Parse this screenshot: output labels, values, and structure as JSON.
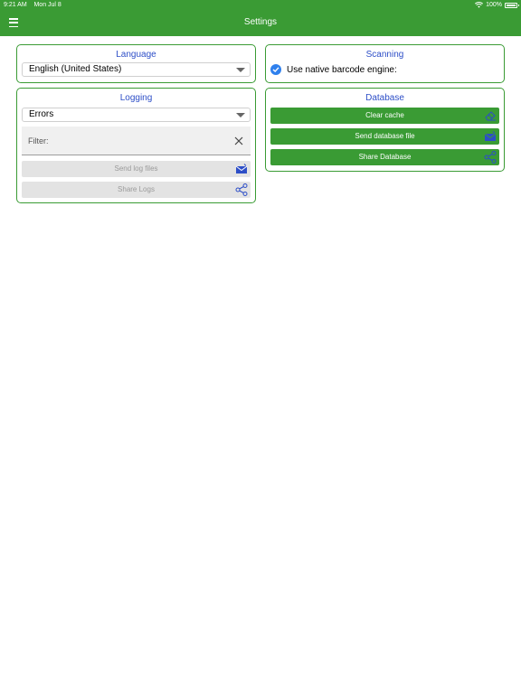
{
  "status_bar": {
    "time": "9:21 AM",
    "date": "Mon Jul 8",
    "battery": "100%"
  },
  "header": {
    "title": "Settings",
    "menu_icon": "hamburger-menu-icon"
  },
  "language": {
    "title": "Language",
    "selected": "English (United States)"
  },
  "logging": {
    "title": "Logging",
    "level": "Errors",
    "filter_placeholder": "Filter:",
    "send_label": "Send log files",
    "share_label": "Share Logs"
  },
  "scanning": {
    "title": "Scanning",
    "native_engine_label": "Use native barcode engine:",
    "native_engine_checked": true
  },
  "database": {
    "title": "Database",
    "clear_label": "Clear cache",
    "send_label": "Send database file",
    "share_label": "Share Database"
  },
  "colors": {
    "accent": "#3a9b34",
    "section_title": "#2d4ec7",
    "icon_blue": "#2d4ec7"
  }
}
